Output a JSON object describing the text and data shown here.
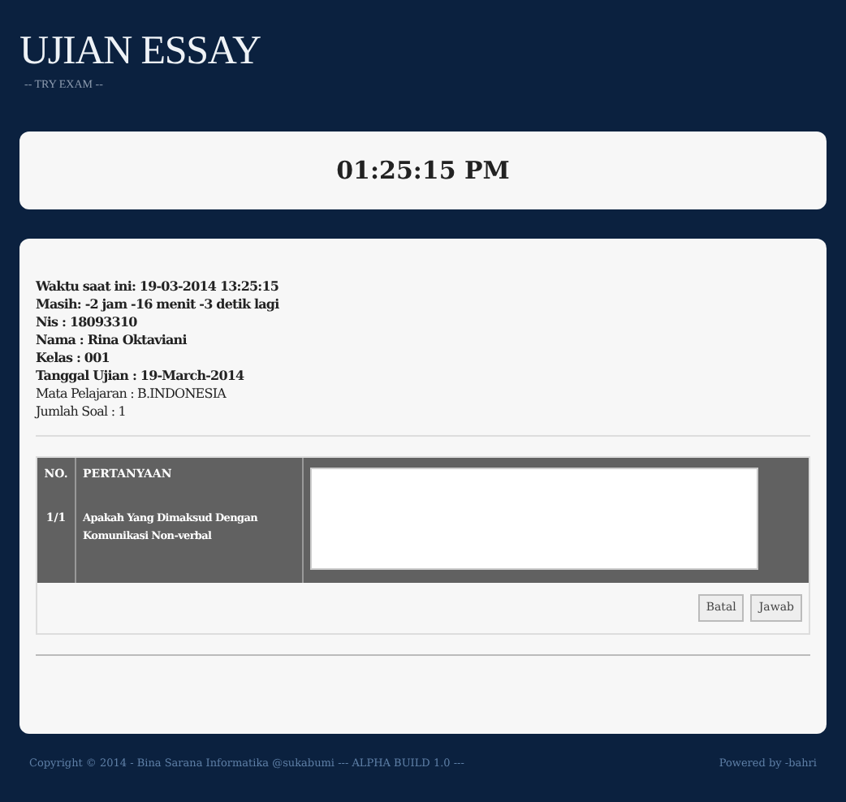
{
  "header": {
    "title": "UJIAN ESSAY",
    "subtitle": "-- TRY EXAM --"
  },
  "clock": "01:25:15 PM",
  "info": [
    {
      "text": "Waktu saat ini: 19-03-2014 13:25:15",
      "bold": true
    },
    {
      "text": "Masih: -2 jam -16 menit -3 detik lagi",
      "bold": true
    },
    {
      "text": "Nis : 18093310",
      "bold": true
    },
    {
      "text": "Nama : Rina Oktaviani",
      "bold": true
    },
    {
      "text": "Kelas : 001",
      "bold": true
    },
    {
      "text": "Tanggal Ujian : 19-March-2014",
      "bold": true
    },
    {
      "text": "Mata Pelajaran : B.INDONESIA",
      "bold": false
    },
    {
      "text": "Jumlah Soal : 1",
      "bold": false
    }
  ],
  "question": {
    "no_header": "NO.",
    "question_header": "PERTANYAAN",
    "number": "1/1",
    "text": "Apakah Yang Dimaksud Dengan Komunikasi Non-verbal"
  },
  "buttons": [
    "Batal",
    "Jawab"
  ],
  "footer": {
    "left": "Copyright © 2014 - Bina Sarana Informatika @sukabumi --- ALPHA BUILD 1.0 ---",
    "right": "Powered by -bahri"
  }
}
